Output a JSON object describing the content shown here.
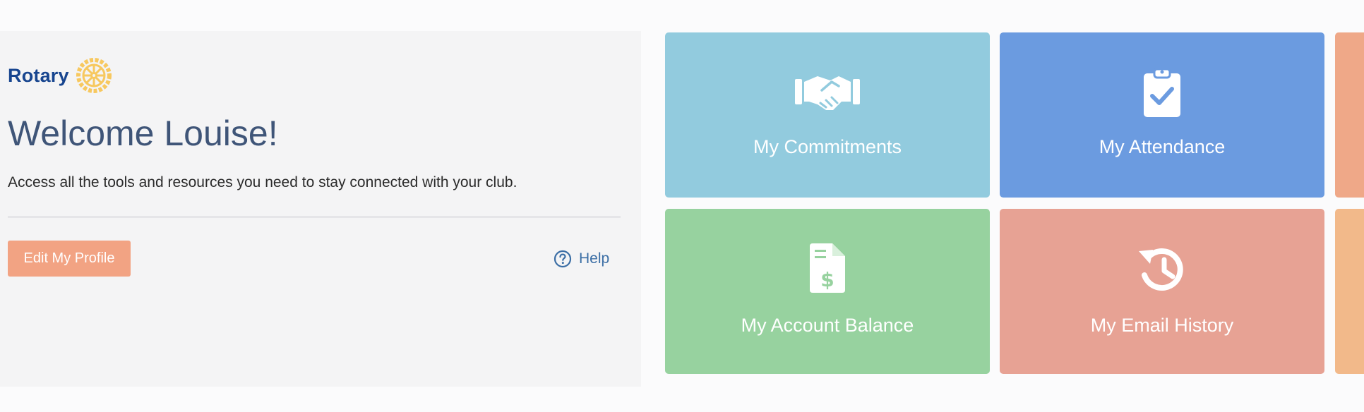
{
  "header": {
    "logo_text": "Rotary",
    "welcome": "Welcome Louise!",
    "tagline": "Access all the tools and resources you need to stay connected with your club."
  },
  "actions": {
    "edit_profile": "Edit My Profile",
    "help": "Help"
  },
  "tiles": [
    {
      "label": "My Commitments",
      "icon": "handshake-icon",
      "color": "#92cbde"
    },
    {
      "label": "My Attendance",
      "icon": "clipboard-check-icon",
      "color": "#6b9be0"
    },
    {
      "label": "My Account Balance",
      "icon": "invoice-dollar-icon",
      "color": "#97d29f"
    },
    {
      "label": "My Email History",
      "icon": "history-icon",
      "color": "#e7a294"
    }
  ],
  "colors": {
    "brand_blue": "#17458f",
    "brand_gold": "#f7c85f",
    "button_orange": "#f2a383",
    "help_blue": "#3b6ea5"
  }
}
